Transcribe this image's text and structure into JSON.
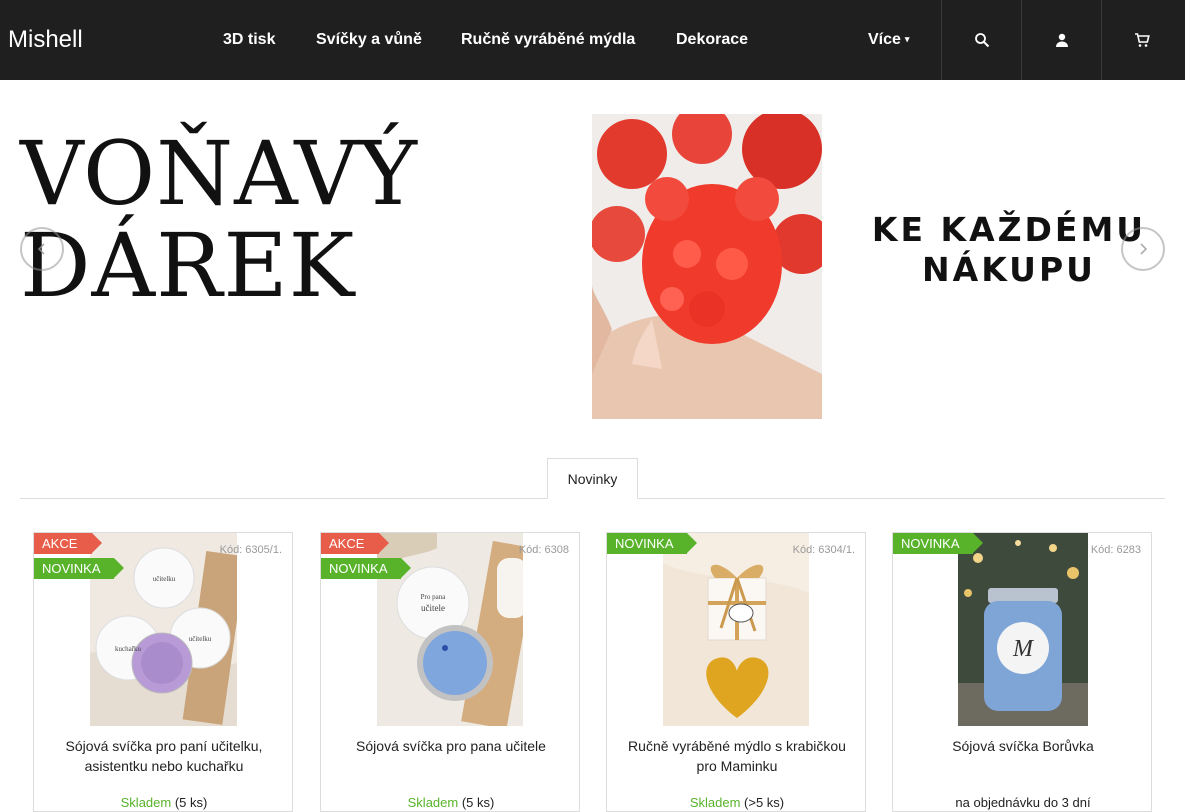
{
  "header": {
    "logo": "Mishell",
    "nav": [
      "3D tisk",
      "Svíčky a vůně",
      "Ručně vyráběné mýdla",
      "Dekorace"
    ],
    "more_label": "Více",
    "icons": [
      "search-icon",
      "user-icon",
      "cart-icon"
    ],
    "colors": {
      "background": "#1f1f1f",
      "text": "#ffffff"
    }
  },
  "banner": {
    "title_line1": "VOŇAVÝ",
    "title_line2": "DÁREK",
    "subtitle_line1": "KE KAŽDÉMU",
    "subtitle_line2": "NÁKUPU",
    "photo": "red-bear-soap-in-hand"
  },
  "tabs": {
    "active": "Novinky"
  },
  "products": [
    {
      "flags": [
        "AKCE",
        "NOVINKA"
      ],
      "code": "Kód: 6305/1.",
      "name": "Sójová svíčka pro paní učitelku, asistentku nebo kuchařku",
      "availability": "Skladem",
      "quantity": "(5 ks)"
    },
    {
      "flags": [
        "AKCE",
        "NOVINKA"
      ],
      "code": "Kód: 6308",
      "name": "Sójová svíčka pro pana učitele",
      "availability": "Skladem",
      "quantity": "(5 ks)"
    },
    {
      "flags": [
        "NOVINKA"
      ],
      "code": "Kód: 6304/1.",
      "name": "Ručně vyráběné mýdlo s krabičkou pro Maminku",
      "availability": "Skladem",
      "quantity": "(>5 ks)"
    },
    {
      "flags": [
        "NOVINKA"
      ],
      "code": "Kód: 6283",
      "name": "Sójová svíčka Borůvka",
      "availability": "na objednávku do 3 dní",
      "quantity": ""
    }
  ],
  "colors": {
    "akce": "#e85d4a",
    "novinka": "#58b32b",
    "in_stock": "#58b32b"
  }
}
